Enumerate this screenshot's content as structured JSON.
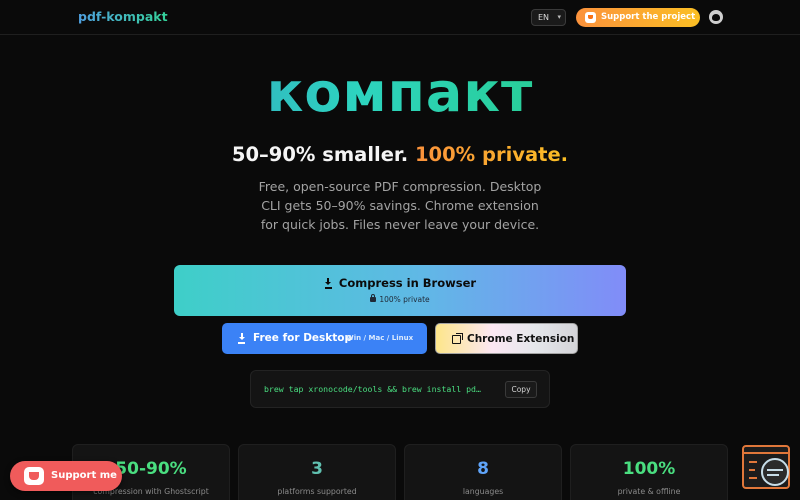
{
  "header": {
    "logo": "pdf-kompakt",
    "language": "EN",
    "support_label": "Support the project"
  },
  "hero": {
    "brand": "компакт",
    "headline_part1": "50–90% smaller.",
    "headline_part2": "100% private.",
    "description": "Free, open-source PDF compression. Desktop CLI gets 50–90% savings. Chrome extension for quick jobs. Files never leave your device."
  },
  "actions": {
    "browser_label": "Compress in Browser",
    "browser_sub": "100% private",
    "desktop_label": "Free for Desktop",
    "desktop_platforms": "Win / Mac / Linux",
    "extension_label": "Chrome Extension"
  },
  "command": {
    "code": "brew tap xronocode/tools && brew install pd…",
    "copy_label": "Copy"
  },
  "stats": [
    {
      "value": "50-90%",
      "label": "compression with Ghostscript"
    },
    {
      "value": "3",
      "label": "platforms supported"
    },
    {
      "value": "8",
      "label": "languages"
    },
    {
      "value": "100%",
      "label": "private & offline"
    }
  ],
  "floating": {
    "support_me": "Support me"
  },
  "colors": {
    "background": "#0a0a0a",
    "accent_blue": "#3b82f6",
    "accent_green": "#4ade80",
    "support_orange": "#fb923c",
    "support_red": "#f05b5b"
  }
}
